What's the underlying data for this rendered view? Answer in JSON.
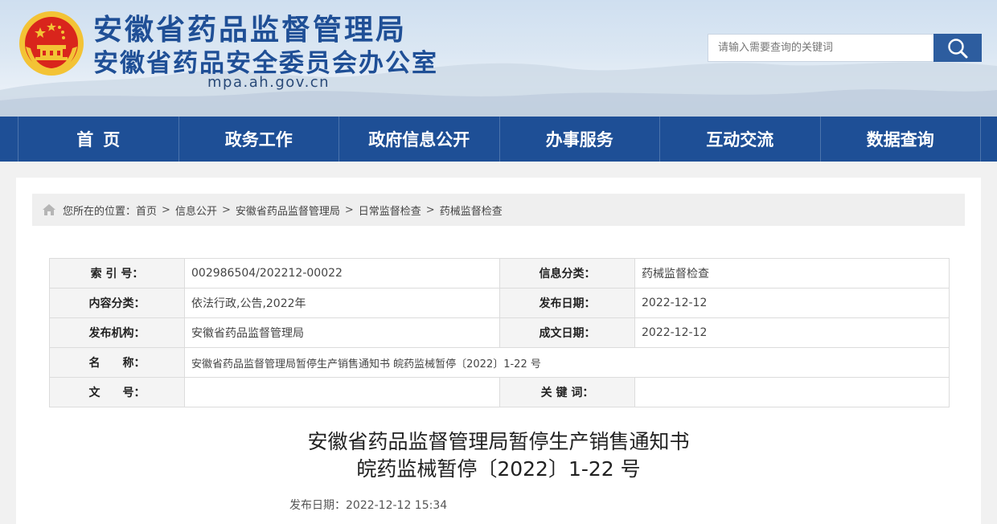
{
  "header": {
    "title_line1": "安徽省药品监督管理局",
    "title_line2": "安徽省药品安全委员会办公室",
    "domain": "mpa.ah.gov.cn",
    "emblem_icon": "national-emblem-icon"
  },
  "search": {
    "placeholder": "请输入需要查询的关键词",
    "button_icon": "search-icon"
  },
  "nav": {
    "items": [
      {
        "label": "首页"
      },
      {
        "label": "政务工作"
      },
      {
        "label": "政府信息公开"
      },
      {
        "label": "办事服务"
      },
      {
        "label": "互动交流"
      },
      {
        "label": "数据查询"
      }
    ]
  },
  "breadcrumb": {
    "prefix": "您所在的位置：",
    "items": [
      "首页",
      "信息公开",
      "安徽省药品监督管理局",
      "日常监督检查",
      "药械监督检查"
    ],
    "separator": ">"
  },
  "meta": {
    "rows": [
      {
        "k1": "索 引 号：",
        "v1": "002986504/202212-00022",
        "k2": "信息分类：",
        "v2": "药械监督检查"
      },
      {
        "k1": "内容分类：",
        "v1": "依法行政,公告,2022年",
        "k2": "发布日期：",
        "v2": "2022-12-12"
      },
      {
        "k1": "发布机构：",
        "v1": "安徽省药品监督管理局",
        "k2": "成文日期：",
        "v2": "2022-12-12"
      },
      {
        "k1": "名　　称：",
        "v1": "安徽省药品监督管理局暂停生产销售通知书 皖药监械暂停〔2022〕1-22 号"
      },
      {
        "k1": "文　　号：",
        "v1": "",
        "k2": "关 键 词：",
        "v2": ""
      }
    ]
  },
  "article": {
    "title_line1": "安徽省药品监督管理局暂停生产销售通知书",
    "title_line2": "皖药监械暂停〔2022〕1-22 号",
    "publish_label": "发布日期：",
    "publish_value": "2022-12-12 15:34"
  },
  "colors": {
    "brand_blue": "#1e4f96",
    "title_blue": "#1f4f96",
    "emblem_red": "#d9251c",
    "emblem_gold": "#f3c335"
  }
}
